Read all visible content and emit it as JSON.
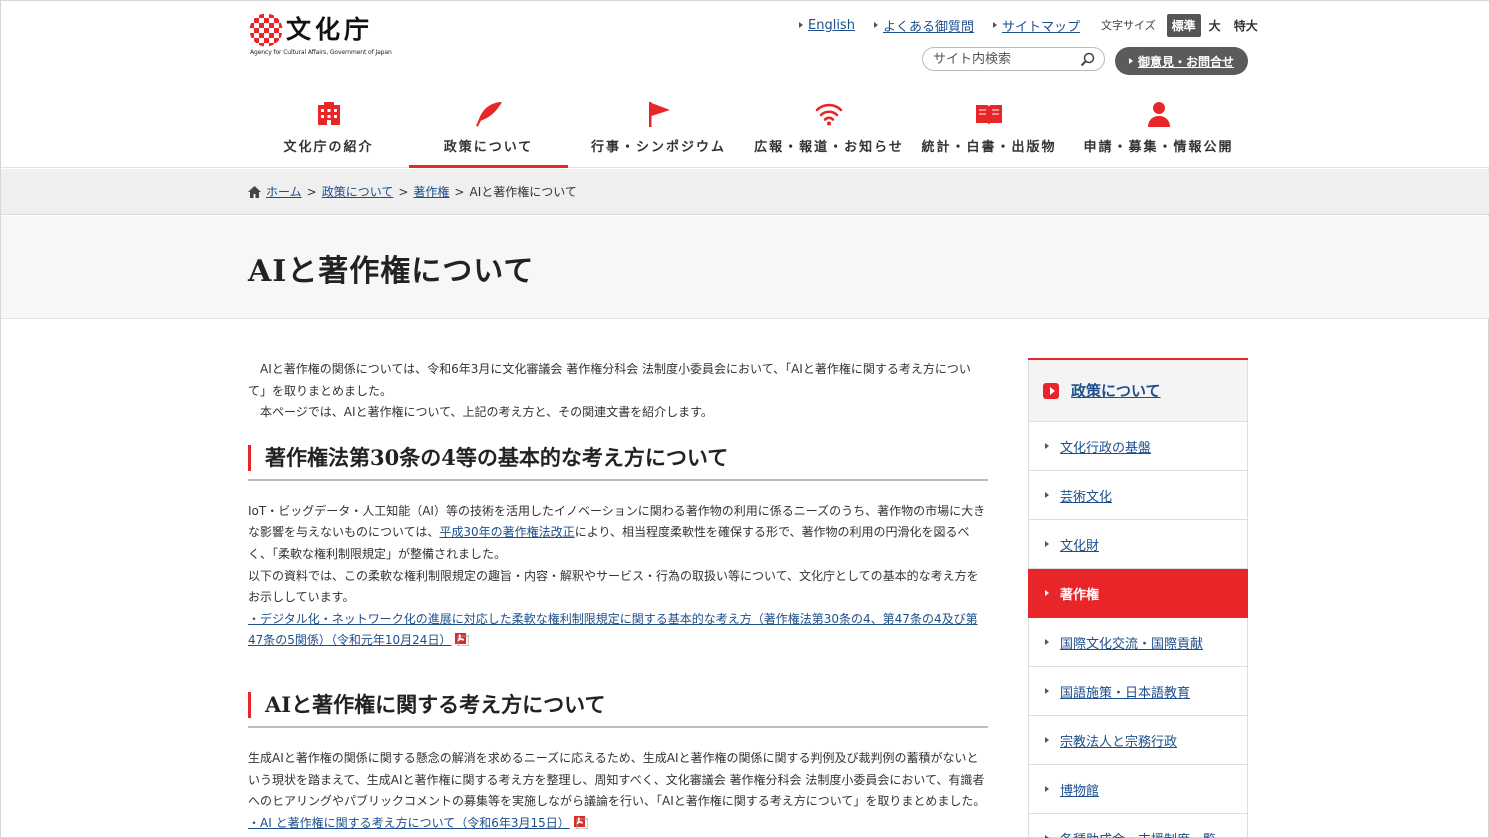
{
  "header": {
    "logo_name": "文化庁",
    "logo_en": "Agency for Cultural Affairs, Government of Japan",
    "util_links": [
      "English",
      "よくある御質問",
      "サイトマップ"
    ],
    "font_size_label": "文字サイズ",
    "font_sizes": [
      "標準",
      "大",
      "特大"
    ],
    "search_placeholder": "サイト内検索",
    "inquiry_label": "御意見・お問合せ"
  },
  "gnav": [
    {
      "label": "文化庁の紹介",
      "icon": "building-icon"
    },
    {
      "label": "政策について",
      "icon": "quill-icon"
    },
    {
      "label": "行事・シンポジウム",
      "icon": "flag-icon"
    },
    {
      "label": "広報・報道・お知らせ",
      "icon": "wifi-icon"
    },
    {
      "label": "統計・白書・出版物",
      "icon": "book-icon"
    },
    {
      "label": "申請・募集・情報公開",
      "icon": "person-icon"
    }
  ],
  "breadcrumb": [
    "ホーム",
    "政策について",
    "著作権",
    "AIと著作権について"
  ],
  "page_title": "AIと著作権について",
  "intro": [
    "AIと著作権の関係については、令和6年3月に文化審議会 著作権分科会 法制度小委員会において、「AIと著作権に関する考え方について」を取りまとめました。",
    "本ページでは、AIと著作権について、上記の考え方と、その関連文書を紹介します。"
  ],
  "section1": {
    "heading": "著作権法第30条の4等の基本的な考え方について",
    "p1_a": "IoT・ビッグデータ・人工知能（AI）等の技術を活用したイノベーションに関わる著作物の利用に係るニーズのうち、著作物の市場に大きな影響を与えないものについては、",
    "p1_link": "平成30年の著作権法改正",
    "p1_b": "により、相当程度柔軟性を確保する形で、著作物の利用の円滑化を図るべく、「柔軟な権利制限規定」が整備されました。",
    "p2": "以下の資料では、この柔軟な権利制限規定の趣旨・内容・解釈やサービス・行為の取扱い等について、文化庁としての基本的な考え方をお示ししています。",
    "doc_link": "・デジタル化・ネットワーク化の進展に対応した柔軟な権利制限規定に関する基本的な考え方（著作権法第30条の4、第47条の4及び第47条の5関係）（令和元年10月24日）"
  },
  "section2": {
    "heading": "AIと著作権に関する考え方について",
    "p1": "生成AIと著作権の関係に関する懸念の解消を求めるニーズに応えるため、生成AIと著作権の関係に関する判例及び裁判例の蓄積がないという現状を踏まえて、生成AIと著作権に関する考え方を整理し、周知すべく、文化審議会 著作権分科会 法制度小委員会において、有識者へのヒアリングやパブリックコメントの募集等を実施しながら議論を行い、「AIと著作権に関する考え方について」を取りまとめました。",
    "doc_link": "・AI と著作権に関する考え方について（令和6年3月15日）"
  },
  "sidebar": {
    "header": "政策について",
    "items": [
      "文化行政の基盤",
      "芸術文化",
      "文化財",
      "著作権",
      "国際文化交流・国際貢献",
      "国語施策・日本語教育",
      "宗教法人と宗務行政",
      "博物館",
      "各種助成金・支援制度一覧"
    ],
    "active": "著作権"
  },
  "colors": {
    "accent": "#e8262a",
    "link": "#1c4f8c",
    "inquiry_bg": "#5b5b5b"
  }
}
